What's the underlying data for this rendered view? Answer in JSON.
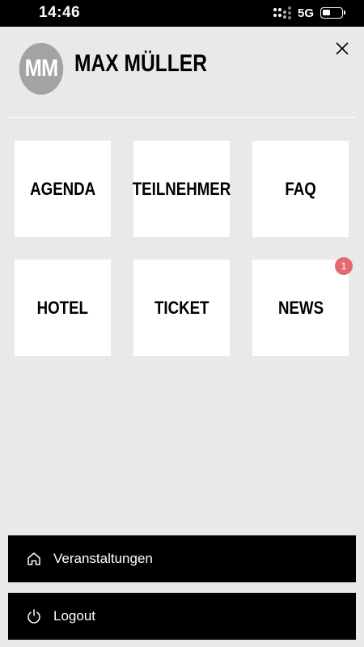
{
  "status_bar": {
    "time": "14:46",
    "network": "5G",
    "icons": [
      "signal-icon",
      "battery-icon"
    ]
  },
  "profile": {
    "initials": "MM",
    "name": "MAX MÜLLER"
  },
  "close_icon": "close-icon",
  "tiles": [
    {
      "label": "AGENDA"
    },
    {
      "label": "TEILNEHMER"
    },
    {
      "label": "FAQ"
    },
    {
      "label": "HOTEL"
    },
    {
      "label": "TICKET"
    },
    {
      "label": "NEWS",
      "badge": "1"
    }
  ],
  "colors": {
    "background": "#e9e9e9",
    "tile": "#ffffff",
    "avatar": "#a3a3a3",
    "badge": "#e36a74",
    "button": "#000000"
  },
  "menu": [
    {
      "label": "Veranstaltungen",
      "icon": "home-icon"
    },
    {
      "label": "Logout",
      "icon": "power-icon"
    }
  ]
}
